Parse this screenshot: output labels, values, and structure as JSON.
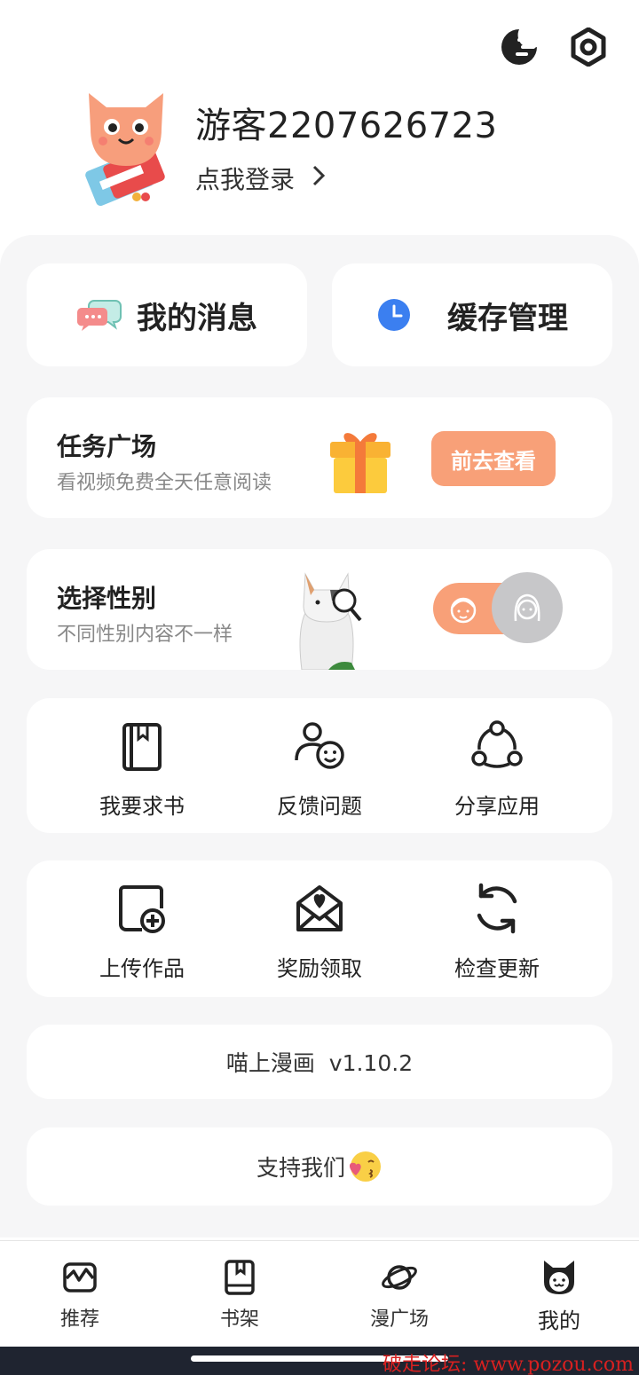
{
  "profile": {
    "username": "游客2207626723",
    "login_prompt": "点我登录",
    "chevron": "›"
  },
  "quick_actions": {
    "messages": "我的消息",
    "cache": "缓存管理"
  },
  "tasks": {
    "title": "任务广场",
    "subtitle": "看视频免费全天任意阅读",
    "button": "前去查看"
  },
  "gender": {
    "title": "选择性别",
    "subtitle": "不同性别内容不一样"
  },
  "grid1": [
    {
      "label": "我要求书"
    },
    {
      "label": "反馈问题"
    },
    {
      "label": "分享应用"
    }
  ],
  "grid2": [
    {
      "label": "上传作品"
    },
    {
      "label": "奖励领取"
    },
    {
      "label": "检查更新"
    }
  ],
  "version": "喵上漫画  v1.10.2",
  "support": "支持我们",
  "tabs": [
    {
      "label": "推荐"
    },
    {
      "label": "书架"
    },
    {
      "label": "漫广场"
    },
    {
      "label": "我的"
    }
  ],
  "watermark": "破走论坛: www.pozou.com",
  "colors": {
    "accent": "#f8a078",
    "panel_bg": "#f6f6f7",
    "card_bg": "#ffffff"
  }
}
